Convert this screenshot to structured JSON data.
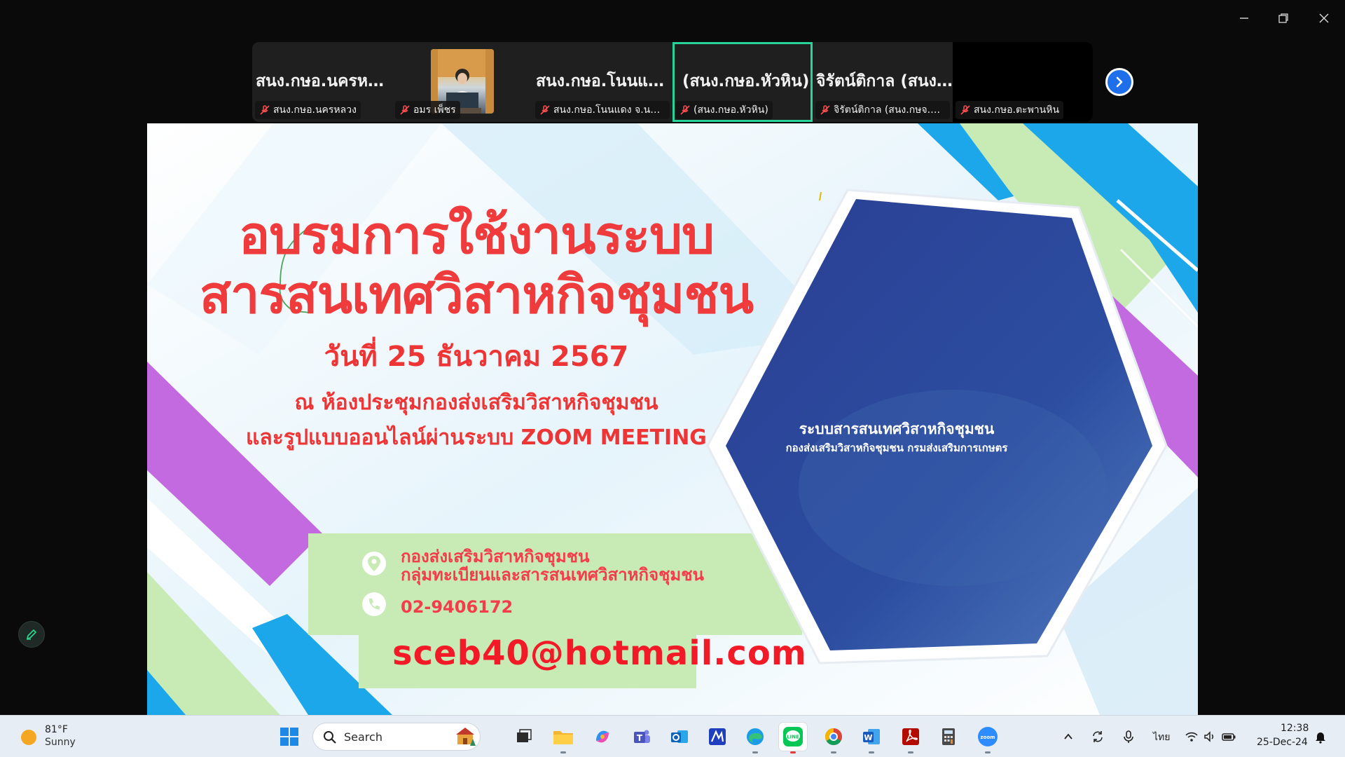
{
  "window_controls": {
    "minimize": "minimize-icon",
    "restore": "restore-icon",
    "close": "close-icon"
  },
  "participants": [
    {
      "big_name": "สนง.กษอ.นครหลวง",
      "label": "สนง.กษอ.นครหลวง",
      "muted": true,
      "active": false
    },
    {
      "big_name": "",
      "label": "อมร เพ็ชร",
      "muted": true,
      "active": false,
      "has_video": true
    },
    {
      "big_name": "สนง.กษอ.โนนแด...",
      "label": "สนง.กษอ.โนนแดง จ.นครร...",
      "muted": true,
      "active": false
    },
    {
      "big_name": "(สนง.กษอ.หัวหิน)",
      "label": "(สนง.กษอ.หัวหิน)",
      "muted": true,
      "active": true
    },
    {
      "big_name": "จิรัตน์ติกาล (สนง....",
      "label": "จิรัตน์ติกาล (สนง.กษจ.ตรัง)",
      "muted": true,
      "active": false
    },
    {
      "big_name": "",
      "label": "สนง.กษอ.ตะพานหิน",
      "muted": true,
      "active": false
    }
  ],
  "slide": {
    "title_line1": "อบรมการใช้งานระบบ",
    "title_line2": "สารสนเทศวิสาหกิจชุมชน",
    "date": "วันที่ 25 ธันวาคม 2567",
    "venue_line1": "ณ ห้องประชุมกองส่งเสริมวิสาหกิจชุมชน",
    "venue_line2": "และรูปแบบออนไลน์ผ่านระบบ ZOOM MEETING",
    "contact_org_line1": "กองส่งเสริมวิสาหกิจชุมชน",
    "contact_org_line2": "กลุ่มทะเบียนและสารสนเทศวิสาหกิจชุมชน",
    "contact_phone": "02-9406172",
    "contact_email": "sceb40@hotmail.com",
    "hex_title": "ระบบสารสนเทศวิสาหกิจชุมชน",
    "hex_subtitle": "กองส่งเสริมวิสาหกิจชุมชน กรมส่งเสริมการเกษตร"
  },
  "colors": {
    "title_red": "#ef3b3b",
    "active_border": "#28d39a",
    "purple": "#c46ae0",
    "green": "#c8eab5",
    "blue": "#1ba7ea",
    "hex_blue": "#243a8c"
  },
  "taskbar": {
    "weather_temp": "81°F",
    "weather_desc": "Sunny",
    "search_label": "Search",
    "language": "ไทย",
    "time": "12:38",
    "date": "25-Dec-24",
    "apps": [
      "start-icon",
      "search-icon",
      "widgets-icon",
      "task-view-icon",
      "file-explorer-icon",
      "copilot-icon",
      "teams-icon",
      "outlook-icon",
      "design-app-icon",
      "edge-icon",
      "line-icon",
      "chrome-icon",
      "word-icon",
      "acrobat-icon",
      "calculator-icon",
      "zoom-icon"
    ]
  }
}
